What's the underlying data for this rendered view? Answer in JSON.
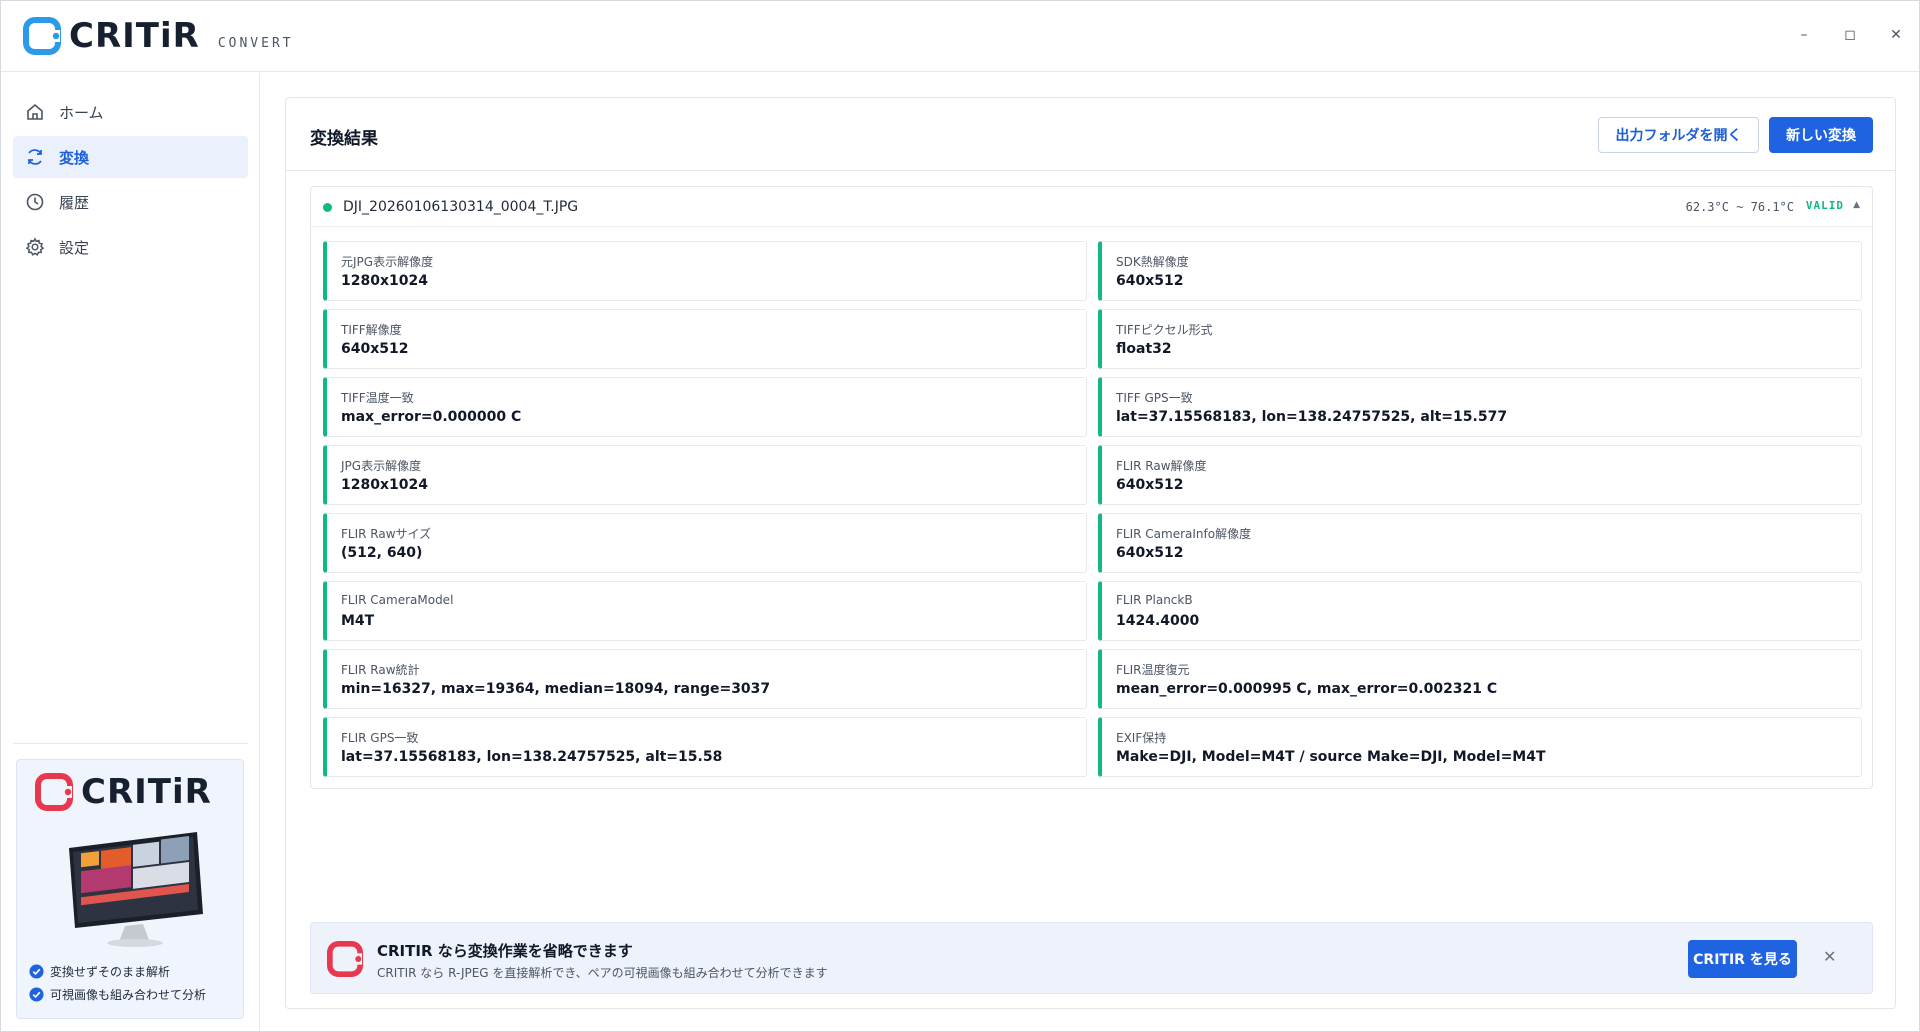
{
  "app": {
    "brand_name": "CRITiR",
    "brand_sub": "CONVERT",
    "window_controls": {
      "minimize": "–",
      "maximize": "◻",
      "close": "✕"
    }
  },
  "colors": {
    "accent": "#1f63e0",
    "brand_blue": "#2b9be8",
    "brand_red": "#e8384f",
    "status_green": "#10b981"
  },
  "sidebar": {
    "items": [
      {
        "label": "ホーム",
        "icon": "home-icon",
        "active": false
      },
      {
        "label": "変換",
        "icon": "refresh-icon",
        "active": true
      },
      {
        "label": "履歴",
        "icon": "clock-icon",
        "active": false
      },
      {
        "label": "設定",
        "icon": "gear-icon",
        "active": false
      }
    ],
    "promo": {
      "logo_name": "CRITiR",
      "features": [
        "変換せずそのまま解析",
        "可視画像も組み合わせて分析"
      ]
    }
  },
  "main": {
    "title": "変換結果",
    "open_folder_label": "出力フォルダを開く",
    "new_convert_label": "新しい変換",
    "result": {
      "file_name": "DJI_20260106130314_0004_T.JPG",
      "temp_range": "62.3°C ~ 76.1°C",
      "status": "VALID",
      "collapse_icon": "▲",
      "rows": [
        [
          {
            "label": "元JPG表示解像度",
            "value": "1280x1024"
          },
          {
            "label": "SDK熱解像度",
            "value": "640x512"
          }
        ],
        [
          {
            "label": "TIFF解像度",
            "value": "640x512"
          },
          {
            "label": "TIFFピクセル形式",
            "value": "float32"
          }
        ],
        [
          {
            "label": "TIFF温度一致",
            "value": "max_error=0.000000 C"
          },
          {
            "label": "TIFF GPS一致",
            "value": "lat=37.15568183, lon=138.24757525, alt=15.577"
          }
        ],
        [
          {
            "label": "JPG表示解像度",
            "value": "1280x1024"
          },
          {
            "label": "FLIR Raw解像度",
            "value": "640x512"
          }
        ],
        [
          {
            "label": "FLIR Rawサイズ",
            "value": "(512, 640)"
          },
          {
            "label": "FLIR CameraInfo解像度",
            "value": "640x512"
          }
        ],
        [
          {
            "label": "FLIR CameraModel",
            "value": "M4T"
          },
          {
            "label": "FLIR PlanckB",
            "value": "1424.4000"
          }
        ],
        [
          {
            "label": "FLIR Raw統計",
            "value": "min=16327, max=19364, median=18094, range=3037"
          },
          {
            "label": "FLIR温度復元",
            "value": "mean_error=0.000995 C, max_error=0.002321 C"
          }
        ],
        [
          {
            "label": "FLIR GPS一致",
            "value": "lat=37.15568183, lon=138.24757525, alt=15.58"
          },
          {
            "label": "EXIF保持",
            "value": "Make=DJI, Model=M4T / source Make=DJI, Model=M4T"
          }
        ]
      ]
    },
    "banner": {
      "title": "CRITIR なら変換作業を省略できます",
      "subtitle": "CRITIR なら R-JPEG を直接解析でき、ペアの可視画像も組み合わせて分析できます",
      "button_label": "CRITIR を見る",
      "close_icon": "✕"
    }
  }
}
